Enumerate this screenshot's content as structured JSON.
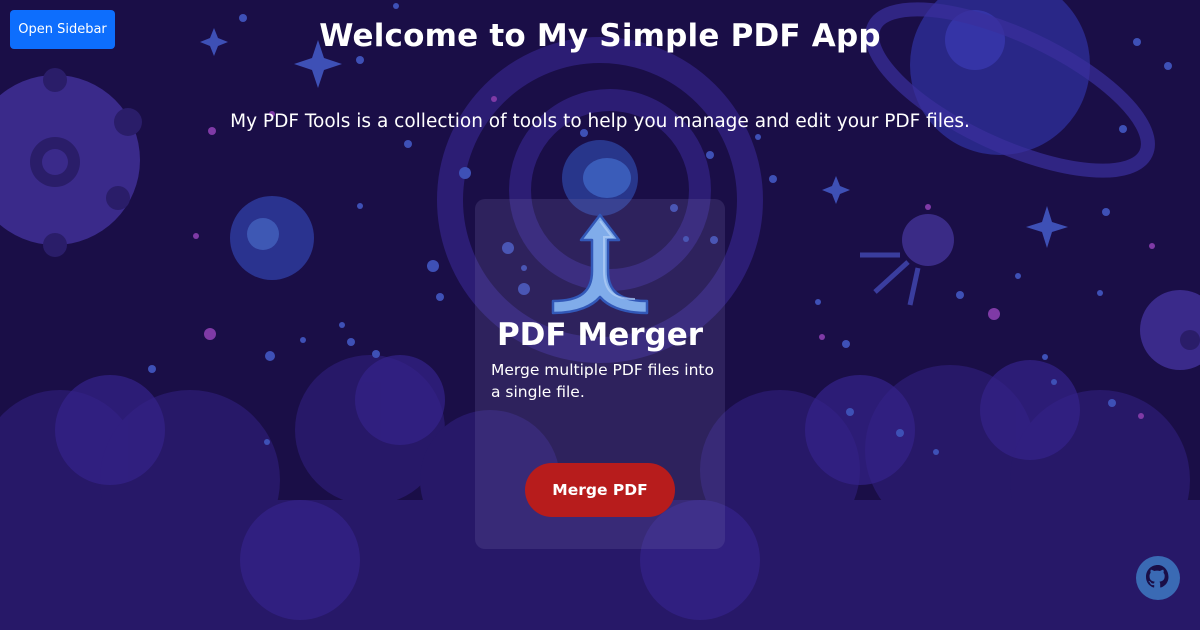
{
  "header": {
    "sidebar_button_label": "Open Sidebar",
    "title": "Welcome to My Simple PDF App",
    "subtitle": "My PDF Tools is a collection of tools to help you manage and edit your PDF files."
  },
  "tools": [
    {
      "icon": "merge-arrow-icon",
      "title": "PDF Merger",
      "description": "Merge multiple PDF files into a single file.",
      "button_label": "Merge PDF"
    }
  ],
  "footer": {
    "github_icon": "github-icon"
  },
  "colors": {
    "background": "#1a0e47",
    "sidebar_button": "#0d6efd",
    "merge_button": "#b71c1c",
    "card": "#3b3268",
    "github_icon": "#3a6ab4"
  }
}
